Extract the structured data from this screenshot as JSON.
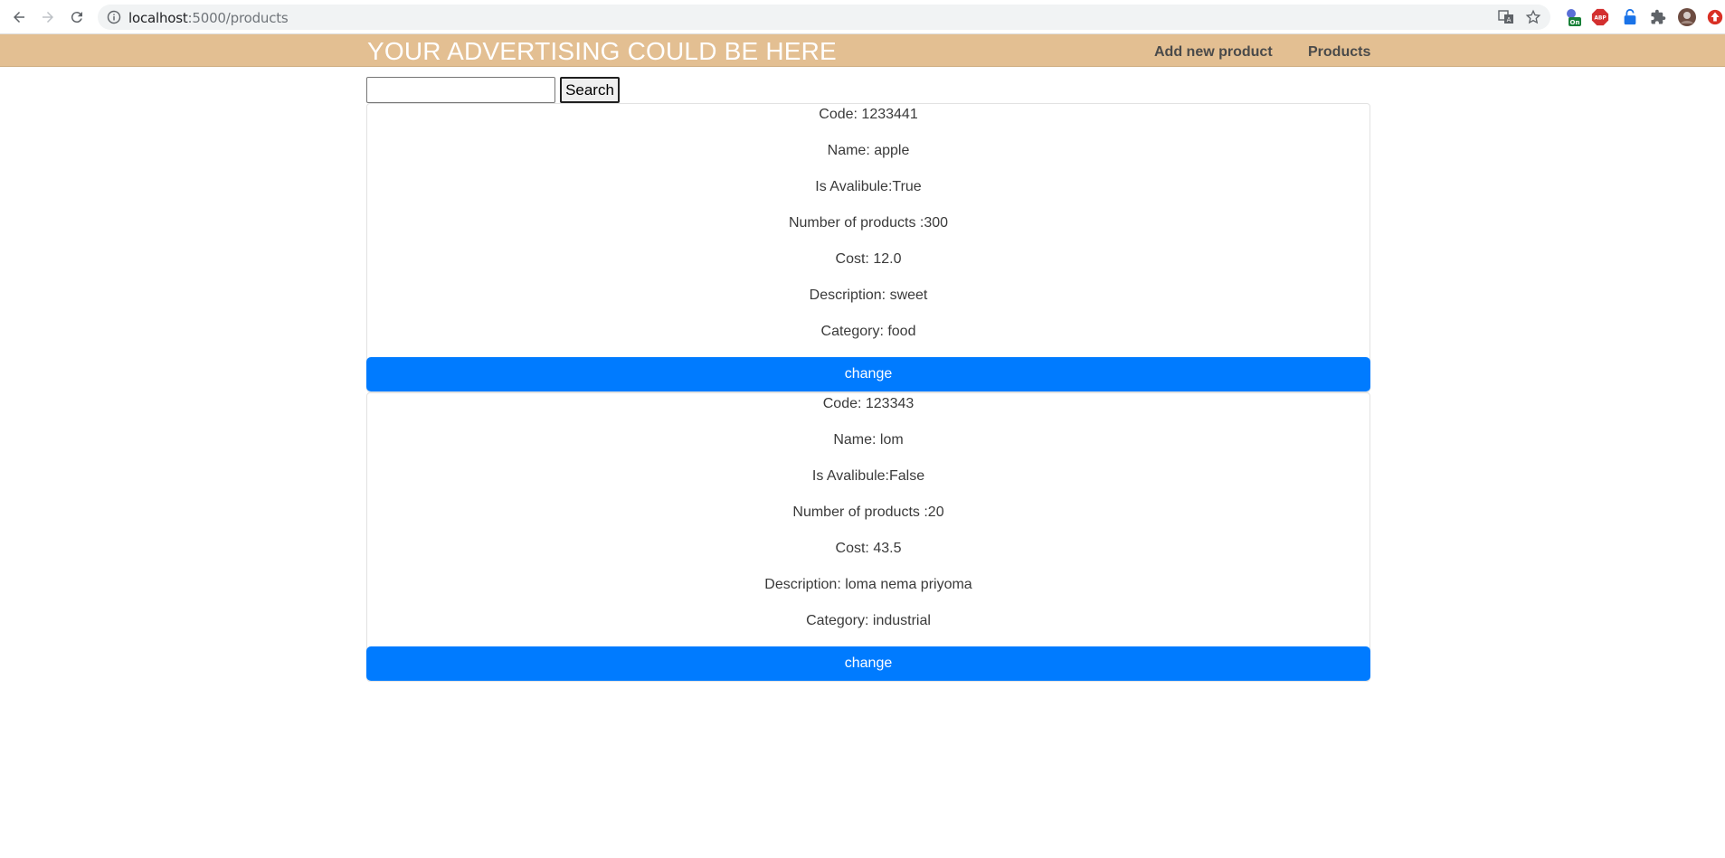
{
  "browser": {
    "url_host": "localhost",
    "url_rest": ":5000/products"
  },
  "header": {
    "brand": "YOUR ADVERTISING COULD BE HERE",
    "nav": {
      "add_new_product": "Add new product",
      "products": "Products"
    }
  },
  "search": {
    "value": "",
    "button_label": "Search"
  },
  "products": [
    {
      "code": "Code: 1233441",
      "name": "Name: apple",
      "available": "Is Avalibule:True",
      "count": "Number of products :300",
      "cost": "Cost: 12.0",
      "description": "Description: sweet",
      "category": "Category: food",
      "button": "change"
    },
    {
      "code": "Code: 123343",
      "name": "Name: lom",
      "available": "Is Avalibule:False",
      "count": "Number of products :20",
      "cost": "Cost: 43.5",
      "description": "Description: loma nema priyoma",
      "category": "Category: industrial",
      "button": "change"
    }
  ],
  "colors": {
    "header_bg": "#e3bf92",
    "button_primary": "#007bff"
  },
  "icons": {
    "back": "arrow-left-icon",
    "forward": "arrow-right-icon",
    "reload": "reload-icon",
    "info": "info-icon",
    "translate": "translate-icon",
    "bookmark": "star-icon",
    "extensions": "puzzle-icon"
  }
}
